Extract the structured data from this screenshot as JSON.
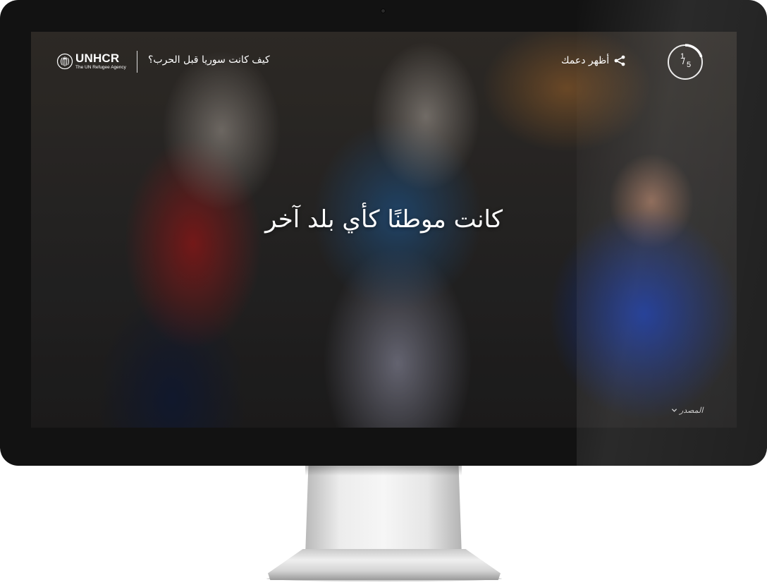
{
  "header": {
    "logo": {
      "name": "UNHCR",
      "tagline": "The UN Refugee Agency"
    },
    "story_title": "كيف كانت سوريا قبل الحرب؟",
    "share_label": "أظهر دعمك",
    "progress": {
      "current": "1",
      "total": "5",
      "fraction": 0.2
    }
  },
  "main": {
    "headline": "كانت موطنًا كأي بلد آخر",
    "source_label": "المصدر"
  },
  "icons": {
    "logo": "unhcr-emblem-icon",
    "share": "share-icon",
    "source": "chevron-down-icon"
  }
}
